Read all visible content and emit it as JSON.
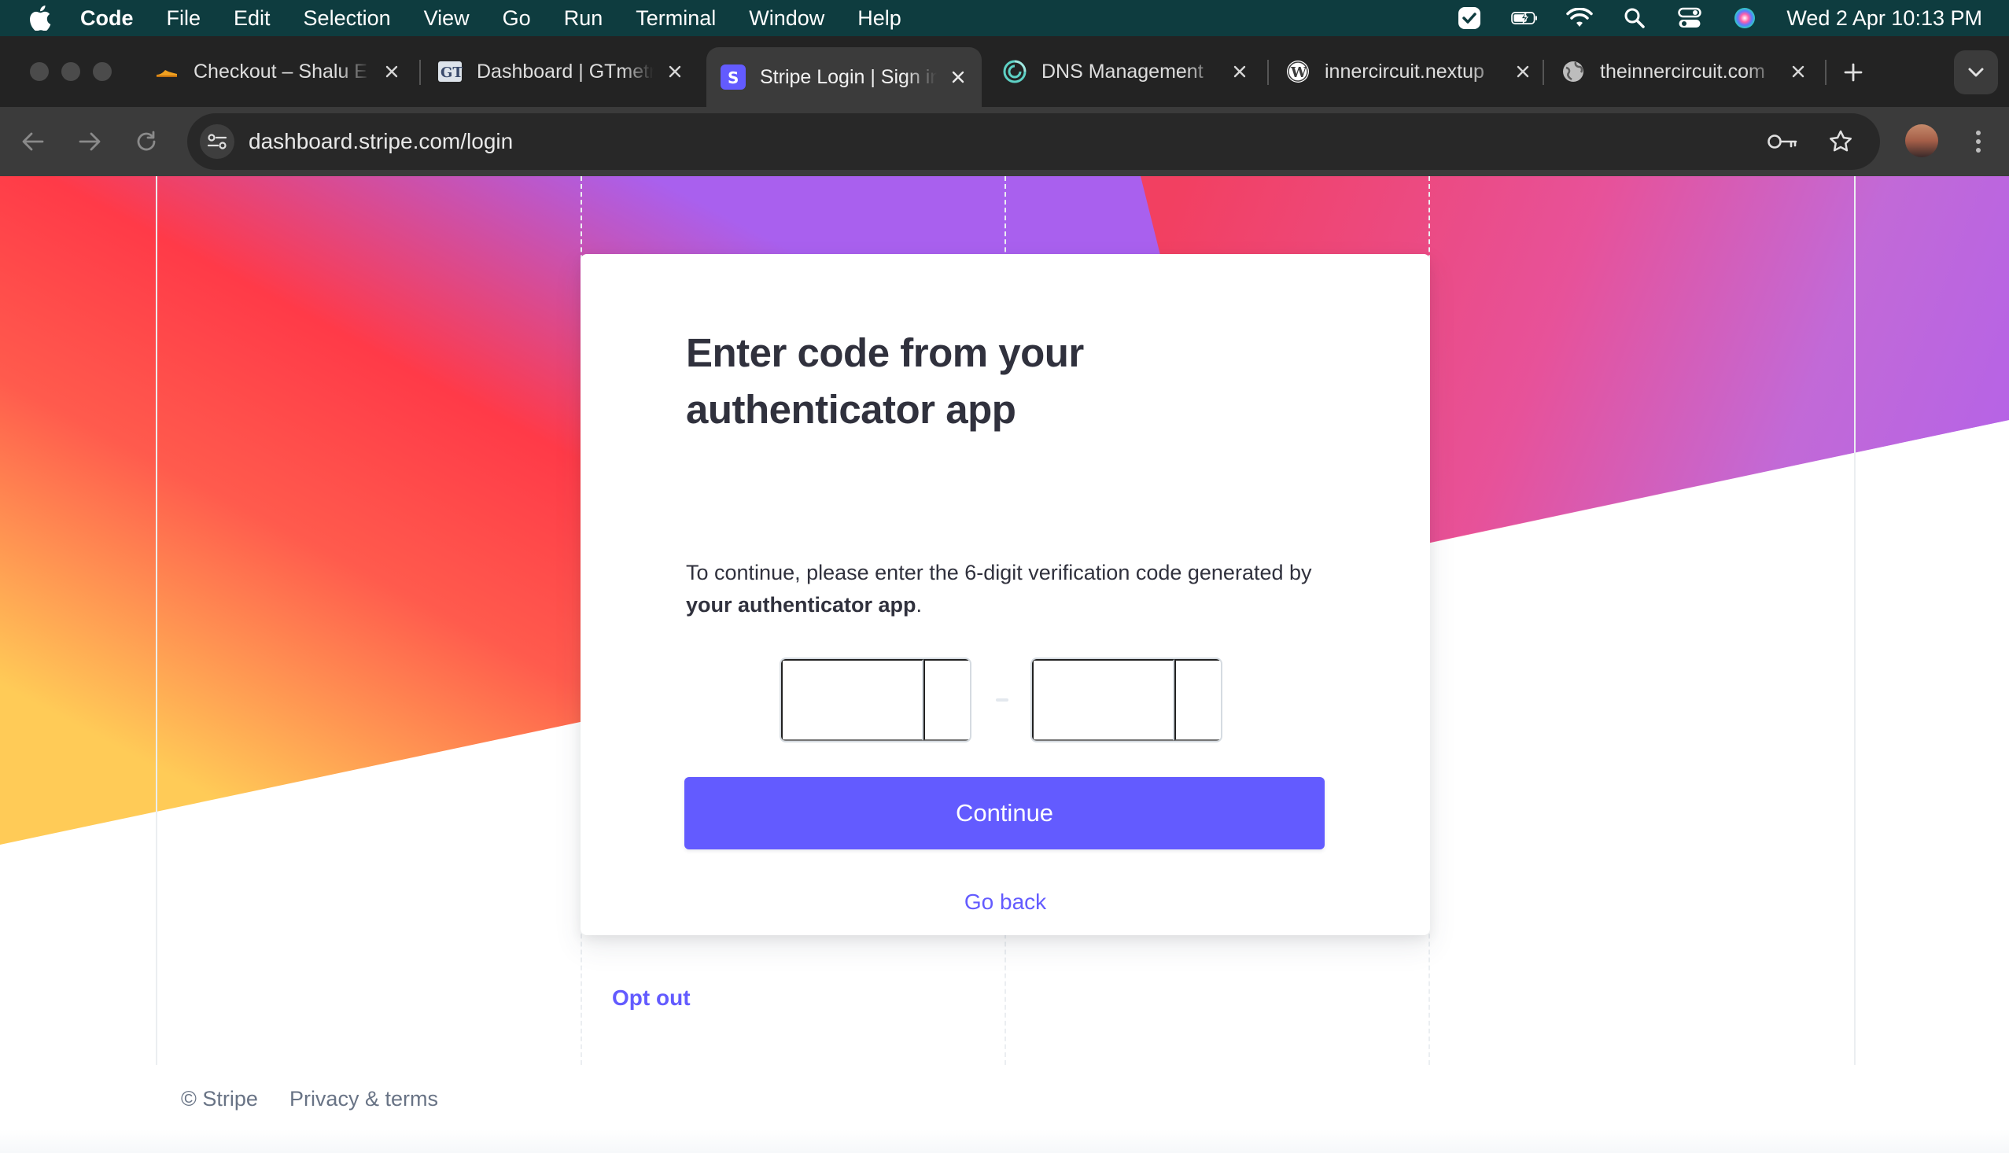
{
  "menubar": {
    "app_name": "Code",
    "items": [
      "File",
      "Edit",
      "Selection",
      "View",
      "Go",
      "Run",
      "Terminal",
      "Window",
      "Help"
    ],
    "clock": "Wed 2 Apr  10:13 PM"
  },
  "browser": {
    "tabs": [
      {
        "title": "Checkout – Shalu E",
        "favicon": "shoe-icon",
        "active": false
      },
      {
        "title": "Dashboard | GTmetrix",
        "favicon": "gtmetrix-icon",
        "active": false
      },
      {
        "title": "Stripe Login | Sign in",
        "favicon": "stripe-icon",
        "active": true
      },
      {
        "title": "DNS Management",
        "favicon": "dns-swirl-icon",
        "active": false
      },
      {
        "title": "innercircuit.nextup",
        "favicon": "wordpress-icon",
        "active": false
      },
      {
        "title": "theinnercircuit.com",
        "favicon": "globe-icon",
        "active": false
      }
    ],
    "url": "dashboard.stripe.com/login"
  },
  "card": {
    "title": "Enter code from your authenticator app",
    "desc_prefix": "To continue, please enter the 6-digit verification code generated by ",
    "desc_bold": "your authenticator app",
    "desc_suffix": ".",
    "continue_label": "Continue",
    "go_back_label": "Go back"
  },
  "opt_out_label": "Opt out",
  "footer": {
    "copyright": "© Stripe",
    "privacy": "Privacy & terms"
  },
  "colors": {
    "accent": "#635bff",
    "heading": "#30313d",
    "muted": "#687385",
    "gradient_purple": "#a960ee",
    "gradient_red": "#ff333d",
    "gradient_yellow": "#ffcb57"
  }
}
